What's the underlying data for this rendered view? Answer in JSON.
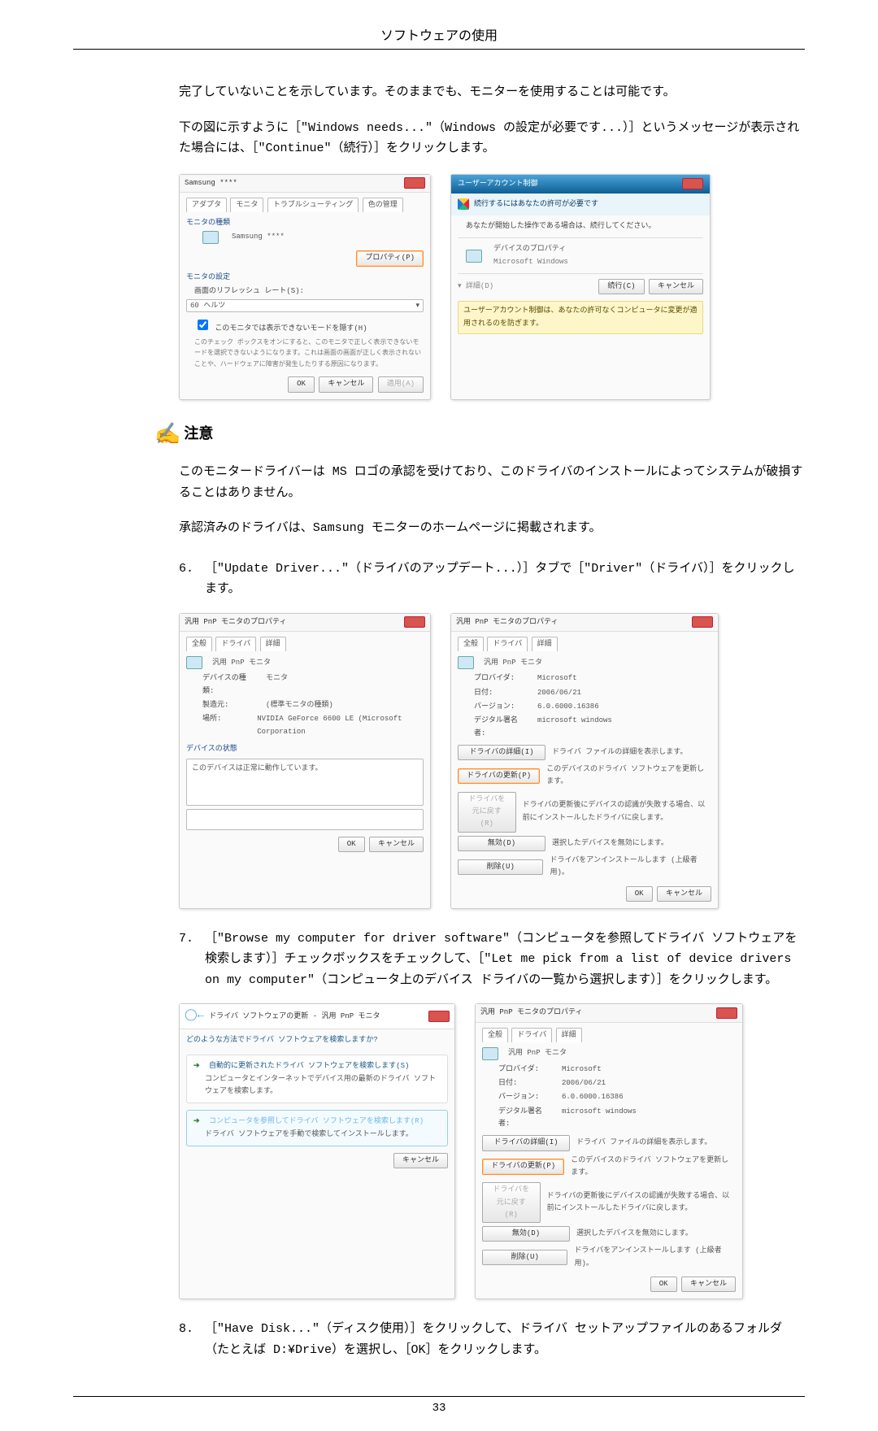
{
  "header": {
    "title": "ソフトウェアの使用"
  },
  "intro": {
    "p1": "完了していないことを示しています。そのままでも、モニターを使用することは可能です。",
    "p2": "下の図に示すように［\"Windows needs...\"（Windows の設定が必要です...）］というメッセージが表示された場合には、［\"Continue\"（続行）］をクリックします。"
  },
  "fig1": {
    "title": "Samsung ****",
    "tab_adapter": "アダプタ",
    "tab_monitor": "モニタ",
    "tab_troubleshoot": "トラブルシューティング",
    "tab_color": "色の管理",
    "sec_type": "モニタの種類",
    "model": "Samsung ****",
    "btn_prop": "プロパティ(P)",
    "sec_set": "モニタの設定",
    "lbl_refresh": "画面のリフレッシュ レート(S):",
    "refresh_val": "60 ヘルツ",
    "chk_hide": "このモニタでは表示できないモードを隠す(H)",
    "chk_note": "このチェック ボックスをオンにすると、このモニタで正しく表示できないモードを選択できないようになります。これは画面の画面が正しく表示されないことや、ハードウェアに障害が発生したりする原因になります。",
    "btn_ok": "OK",
    "btn_cancel": "キャンセル",
    "btn_apply": "適用(A)"
  },
  "fig2": {
    "title": "ユーザーアカウント制御",
    "line1": "続行するにはあなたの許可が必要です",
    "line2": "あなたが開始した操作である場合は、続行してください。",
    "app_name": "デバイスのプロパティ",
    "app_pub": "Microsoft Windows",
    "btn_details": "詳細(D)",
    "btn_continue": "続行(C)",
    "btn_cancel": "キャンセル",
    "warn": "ユーザーアカウント制御は、あなたの許可なくコンピュータに変更が適用されるのを防ぎます。"
  },
  "note": {
    "label": "注意",
    "p1": "このモニタードライバーは MS ロゴの承認を受けており、このドライバのインストールによってシステムが破損することはありません。",
    "p2": "承認済みのドライバは、Samsung モニターのホームページに掲載されます。"
  },
  "step6": {
    "num": "6.",
    "text": "［\"Update Driver...\"（ドライバのアップデート...）］タブで［\"Driver\"（ドライバ）］をクリックします。"
  },
  "fig3": {
    "title": "汎用 PnP モニタのプロパティ",
    "tab_general": "全般",
    "tab_driver": "ドライバ",
    "tab_detail": "詳細",
    "name": "汎用 PnP モニタ",
    "k_type": "デバイスの種類:",
    "v_type": "モニタ",
    "k_mfr": "製造元:",
    "v_mfr": "(標準モニタの種類)",
    "k_loc": "場所:",
    "v_loc": "NVIDIA GeForce 6600 LE (Microsoft Corporation",
    "sec_state": "デバイスの状態",
    "state_text": "このデバイスは正常に動作しています。",
    "btn_ok": "OK",
    "btn_cancel": "キャンセル"
  },
  "fig4": {
    "title": "汎用 PnP モニタのプロパティ",
    "tab_general": "全般",
    "tab_driver": "ドライバ",
    "tab_detail": "詳細",
    "name": "汎用 PnP モニタ",
    "k_prov": "プロバイダ:",
    "v_prov": "Microsoft",
    "k_date": "日付:",
    "v_date": "2006/06/21",
    "k_ver": "バージョン:",
    "v_ver": "6.0.6000.16386",
    "k_sign": "デジタル署名者:",
    "v_sign": "microsoft windows",
    "btn1": "ドライバの詳細(I)",
    "btn1_txt": "ドライバ ファイルの詳細を表示します。",
    "btn2": "ドライバの更新(P)",
    "btn2_txt": "このデバイスのドライバ ソフトウェアを更新します。",
    "btn3": "ドライバを元に戻す(R)",
    "btn3_txt": "ドライバの更新後にデバイスの認識が失敗する場合、以前にインストールしたドライバに戻します。",
    "btn4": "無効(D)",
    "btn4_txt": "選択したデバイスを無効にします。",
    "btn5": "削除(U)",
    "btn5_txt": "ドライバをアンインストールします (上級者用)。",
    "btn_ok": "OK",
    "btn_cancel": "キャンセル"
  },
  "step7": {
    "num": "7.",
    "text": "［\"Browse my computer for driver software\"（コンピュータを参照してドライバ ソフトウェアを検索します）］チェックボックスをチェックして、［\"Let me pick from a list of device drivers on my computer\"（コンピュータ上のデバイス ドライバの一覧から選択します）］をクリックします。"
  },
  "fig5": {
    "title": "ドライバ ソフトウェアの更新 - 汎用 PnP モニタ",
    "q": "どのような方法でドライバ ソフトウェアを検索しますか?",
    "opt1_title": "自動的に更新されたドライバ ソフトウェアを検索します(S)",
    "opt1_body": "コンピュータとインターネットでデバイス用の最新のドライバ ソフトウェアを検索します。",
    "opt2_title": "コンピュータを参照してドライバ ソフトウェアを検索します(R)",
    "opt2_body": "ドライバ ソフトウェアを手動で検索してインストールします。",
    "btn_cancel": "キャンセル"
  },
  "fig6": {
    "title": "汎用 PnP モニタのプロパティ",
    "tab_general": "全般",
    "tab_driver": "ドライバ",
    "tab_detail": "詳細",
    "name": "汎用 PnP モニタ",
    "k_prov": "プロバイダ:",
    "v_prov": "Microsoft",
    "k_date": "日付:",
    "v_date": "2006/06/21",
    "k_ver": "バージョン:",
    "v_ver": "6.0.6000.16386",
    "k_sign": "デジタル署名者:",
    "v_sign": "microsoft windows",
    "btn1": "ドライバの詳細(I)",
    "btn1_txt": "ドライバ ファイルの詳細を表示します。",
    "btn2": "ドライバの更新(P)",
    "btn2_txt": "このデバイスのドライバ ソフトウェアを更新します。",
    "btn3": "ドライバを元に戻す(R)",
    "btn3_txt": "ドライバの更新後にデバイスの認識が失敗する場合、以前にインストールしたドライバに戻します。",
    "btn4": "無効(D)",
    "btn4_txt": "選択したデバイスを無効にします。",
    "btn5": "削除(U)",
    "btn5_txt": "ドライバをアンインストールします (上級者用)。",
    "btn_ok": "OK",
    "btn_cancel": "キャンセル"
  },
  "step8": {
    "num": "8.",
    "text": "［\"Have Disk...\"（ディスク使用）］をクリックして、ドライバ セットアップファイルのあるフォルダ（たとえば D:¥Drive）を選択し、［OK］をクリックします。"
  },
  "footer": {
    "page": "33"
  }
}
